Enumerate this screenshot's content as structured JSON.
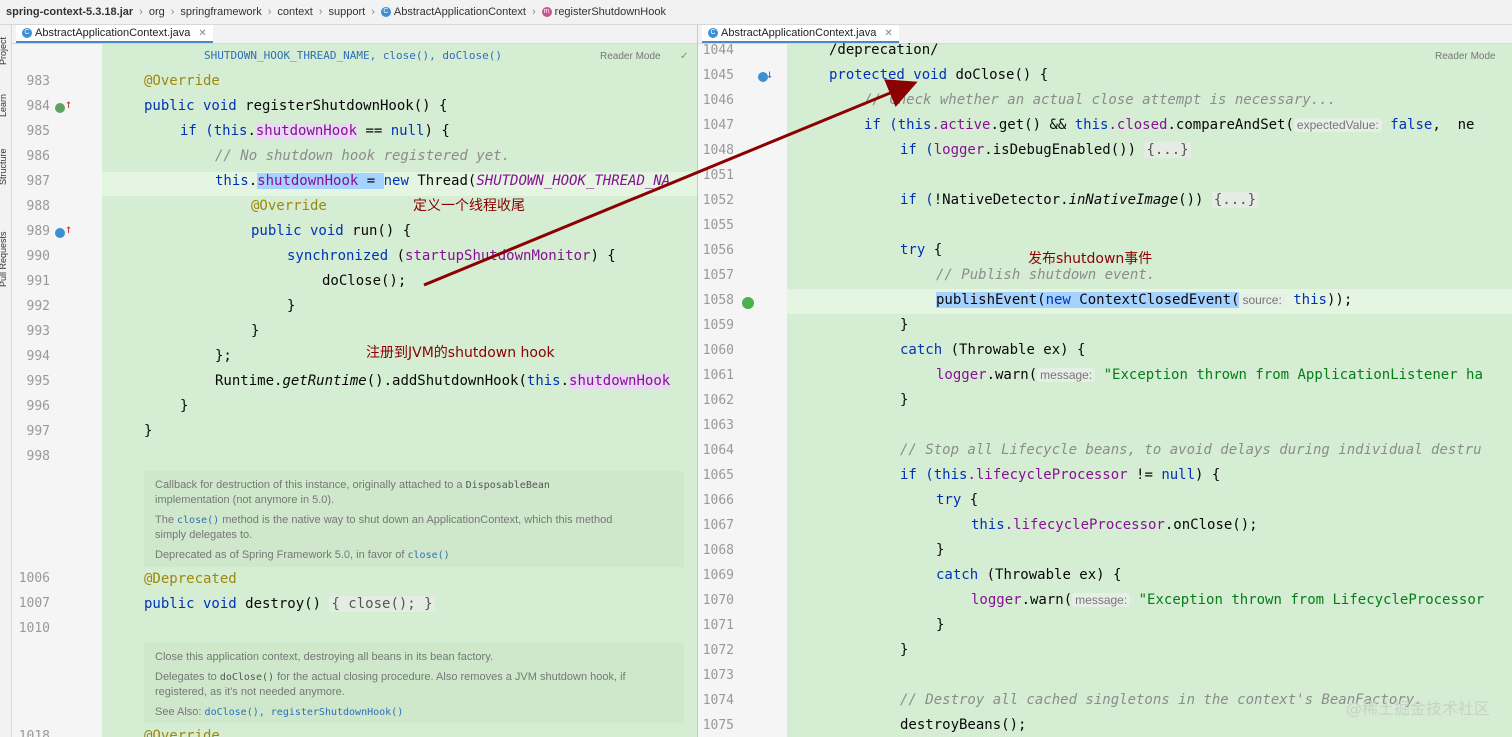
{
  "breadcrumb": [
    "spring-context-5.3.18.jar",
    "org",
    "springframework",
    "context",
    "support",
    "AbstractApplicationContext",
    "registerShutdownHook"
  ],
  "tool_windows": [
    "Project",
    "Learn",
    "Structure",
    "Pull Requests"
  ],
  "left_tab": "AbstractApplicationContext.java",
  "right_tab": "AbstractApplicationContext.java",
  "reader_mode": "Reader Mode",
  "left_top_fragment": "SHUTDOWN_HOOK_THREAD_NAME, close(), doClose()",
  "left_lines": [
    "983",
    "984",
    "985",
    "986",
    "987",
    "988",
    "989",
    "990",
    "991",
    "992",
    "993",
    "994",
    "995",
    "996",
    "997",
    "998"
  ],
  "left_code": {
    "l983": "@Override",
    "l984_kw": "public void",
    "l984_rest": " registerShutdownHook() {",
    "l985_a": "if (",
    "l985_this": "this",
    "l985_dot": ".",
    "l985_fld": "shutdownHook",
    "l985_b": " == ",
    "l985_null": "null",
    "l985_c": ") {",
    "l986": "// No shutdown hook registered yet.",
    "l987_this": "this",
    "l987_fld": "shutdownHook",
    "l987_eq": " = ",
    "l987_new": "new",
    "l987_thread": " Thread(",
    "l987_const": "SHUTDOWN_HOOK_THREAD_NA",
    "l988": "@Override",
    "l989_kw": "public void",
    "l989_rest": " run() {",
    "l990_kw": "synchronized",
    "l990_a": " (",
    "l990_fld": "startupShutdownMonitor",
    "l990_b": ") {",
    "l991": "doClose();",
    "l992": "}",
    "l993": "}",
    "l994": "};",
    "l995_a": "Runtime.",
    "l995_it": "getRuntime",
    "l995_b": "().addShutdownHook(",
    "l995_this": "this",
    "l995_dot": ".",
    "l995_fld": "shutdownHook",
    "l996": "}",
    "l997": "}"
  },
  "doc1": {
    "p1_a": "Callback for destruction of this instance, originally attached to a ",
    "p1_code": "DisposableBean",
    "p1_b": "implementation (not anymore in 5.0).",
    "p2_a": "The ",
    "p2_link": "close()",
    "p2_b": " method is the native way to shut down an ApplicationContext, which this method",
    "p2_c": "simply delegates to.",
    "p3_a": "Deprecated as of Spring Framework 5.0, in favor of ",
    "p3_link": "close()"
  },
  "left_lines2": [
    "1006",
    "1007",
    "1010"
  ],
  "left_code2": {
    "l1006": "@Deprecated",
    "l1007_kw": "public void",
    "l1007_a": " destroy() ",
    "l1007_fold": "{ close(); }"
  },
  "doc2": {
    "p1": "Close this application context, destroying all beans in its bean factory.",
    "p2_a": "Delegates to ",
    "p2_code": "doClose()",
    "p2_b": " for the actual closing procedure. Also removes a JVM shutdown hook, if",
    "p2_c": "registered, as it's not needed anymore.",
    "p3_a": "See Also: ",
    "p3_link": "doClose(), registerShutdownHook()"
  },
  "left_bottom_ln": "1018",
  "left_bottom_code": "@Override",
  "right_lines": [
    "1044",
    "1045",
    "1046",
    "1047",
    "1048",
    "1051",
    "1052",
    "1055",
    "1056",
    "1057",
    "1058",
    "1059",
    "1060",
    "1061",
    "1062",
    "1063",
    "1064",
    "1065",
    "1066",
    "1067",
    "1068",
    "1069",
    "1070",
    "1071",
    "1072",
    "1073",
    "1074",
    "1075"
  ],
  "right_code": {
    "r1044": "/deprecation/",
    "r1045_kw": "protected void",
    "r1045_rest": " doClose() {",
    "r1046": "// Check whether an actual close attempt is necessary...",
    "r1047_if": "if (",
    "r1047_this1": "this",
    "r1047_fld1": ".active",
    "r1047_a": ".get() && ",
    "r1047_this2": "this",
    "r1047_fld2": ".closed",
    "r1047_b": ".compareAndSet(",
    "r1047_hint": "expectedValue:",
    "r1047_false": " false",
    "r1047_c": ",  ne",
    "r1048_if": "if (",
    "r1048_fld": "logger",
    "r1048_a": ".isDebugEnabled()) ",
    "r1048_fold": "{...}",
    "r1052_if": "if (",
    "r1052_a": "!NativeDetector.",
    "r1052_it": "inNativeImage",
    "r1052_b": "()) ",
    "r1052_fold": "{...}",
    "r1056_try": "try",
    "r1056_b": " {",
    "r1057": "// Publish shutdown event.",
    "r1058_a": "publishEvent(",
    "r1058_new": "new",
    "r1058_b": " ContextClosedEvent(",
    "r1058_hint": "source:",
    "r1058_this": " this",
    "r1058_c": "));",
    "r1059": "}",
    "r1060_catch": "catch",
    "r1060_b": " (Throwable ex) {",
    "r1061_fld": "logger",
    "r1061_a": ".warn(",
    "r1061_hint": "message:",
    "r1061_str": " \"Exception thrown from ApplicationListener ha",
    "r1062": "}",
    "r1064": "// Stop all Lifecycle beans, to avoid delays during individual destru",
    "r1065_if": "if (",
    "r1065_this": "this",
    "r1065_fld": ".lifecycleProcessor",
    "r1065_a": " != ",
    "r1065_null": "null",
    "r1065_b": ") {",
    "r1066_try": "try",
    "r1066_b": " {",
    "r1067_this": "this",
    "r1067_fld": ".lifecycleProcessor",
    "r1067_a": ".onClose();",
    "r1068": "}",
    "r1069_catch": "catch",
    "r1069_b": " (Throwable ex) {",
    "r1070_fld": "logger",
    "r1070_a": ".warn(",
    "r1070_hint": "message:",
    "r1070_str": " \"Exception thrown from LifecycleProcessor",
    "r1071": "}",
    "r1072": "}",
    "r1074": "// Destroy all cached singletons in the context's BeanFactory.",
    "r1075": "destroyBeans();"
  },
  "annotations": {
    "thread_close": "定义一个线程收尾",
    "register_hook": "注册到JVM的shutdown hook",
    "publish_event": "发布shutdown事件"
  },
  "watermark": "@稀土掘金技术社区",
  "colors": {
    "code_bg": "#d5edd3",
    "keyword": "#0033b3",
    "annotation": "#9e880d",
    "field": "#871094",
    "comment": "#8c8c8c",
    "string": "#067d17",
    "arrow": "#8b0000"
  }
}
